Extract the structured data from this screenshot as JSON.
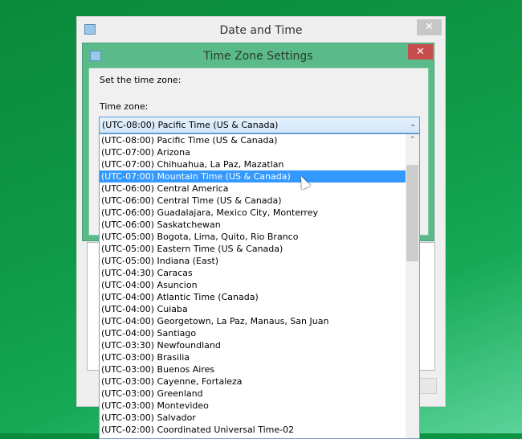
{
  "outer_window": {
    "title": "Date and Time",
    "close": "✕"
  },
  "dialog": {
    "title": "Time Zone Settings",
    "close": "✕",
    "instruction": "Set the time zone:",
    "timezone_label": "Time zone:",
    "selected": "(UTC-08:00) Pacific Time (US & Canada)",
    "highlighted_index": 3,
    "options": [
      "(UTC-08:00) Pacific Time (US & Canada)",
      "(UTC-07:00) Arizona",
      "(UTC-07:00) Chihuahua, La Paz, Mazatlan",
      "(UTC-07:00) Mountain Time (US & Canada)",
      "(UTC-06:00) Central America",
      "(UTC-06:00) Central Time (US & Canada)",
      "(UTC-06:00) Guadalajara, Mexico City, Monterrey",
      "(UTC-06:00) Saskatchewan",
      "(UTC-05:00) Bogota, Lima, Quito, Rio Branco",
      "(UTC-05:00) Eastern Time (US & Canada)",
      "(UTC-05:00) Indiana (East)",
      "(UTC-04:30) Caracas",
      "(UTC-04:00) Asuncion",
      "(UTC-04:00) Atlantic Time (Canada)",
      "(UTC-04:00) Cuiaba",
      "(UTC-04:00) Georgetown, La Paz, Manaus, San Juan",
      "(UTC-04:00) Santiago",
      "(UTC-03:30) Newfoundland",
      "(UTC-03:00) Brasilia",
      "(UTC-03:00) Buenos Aires",
      "(UTC-03:00) Cayenne, Fortaleza",
      "(UTC-03:00) Greenland",
      "(UTC-03:00) Montevideo",
      "(UTC-03:00) Salvador",
      "(UTC-02:00) Coordinated Universal Time-02"
    ]
  },
  "colors": {
    "dialog_frame": "#5aba8a",
    "close_red": "#c74c4c",
    "selection": "#3399ff"
  }
}
